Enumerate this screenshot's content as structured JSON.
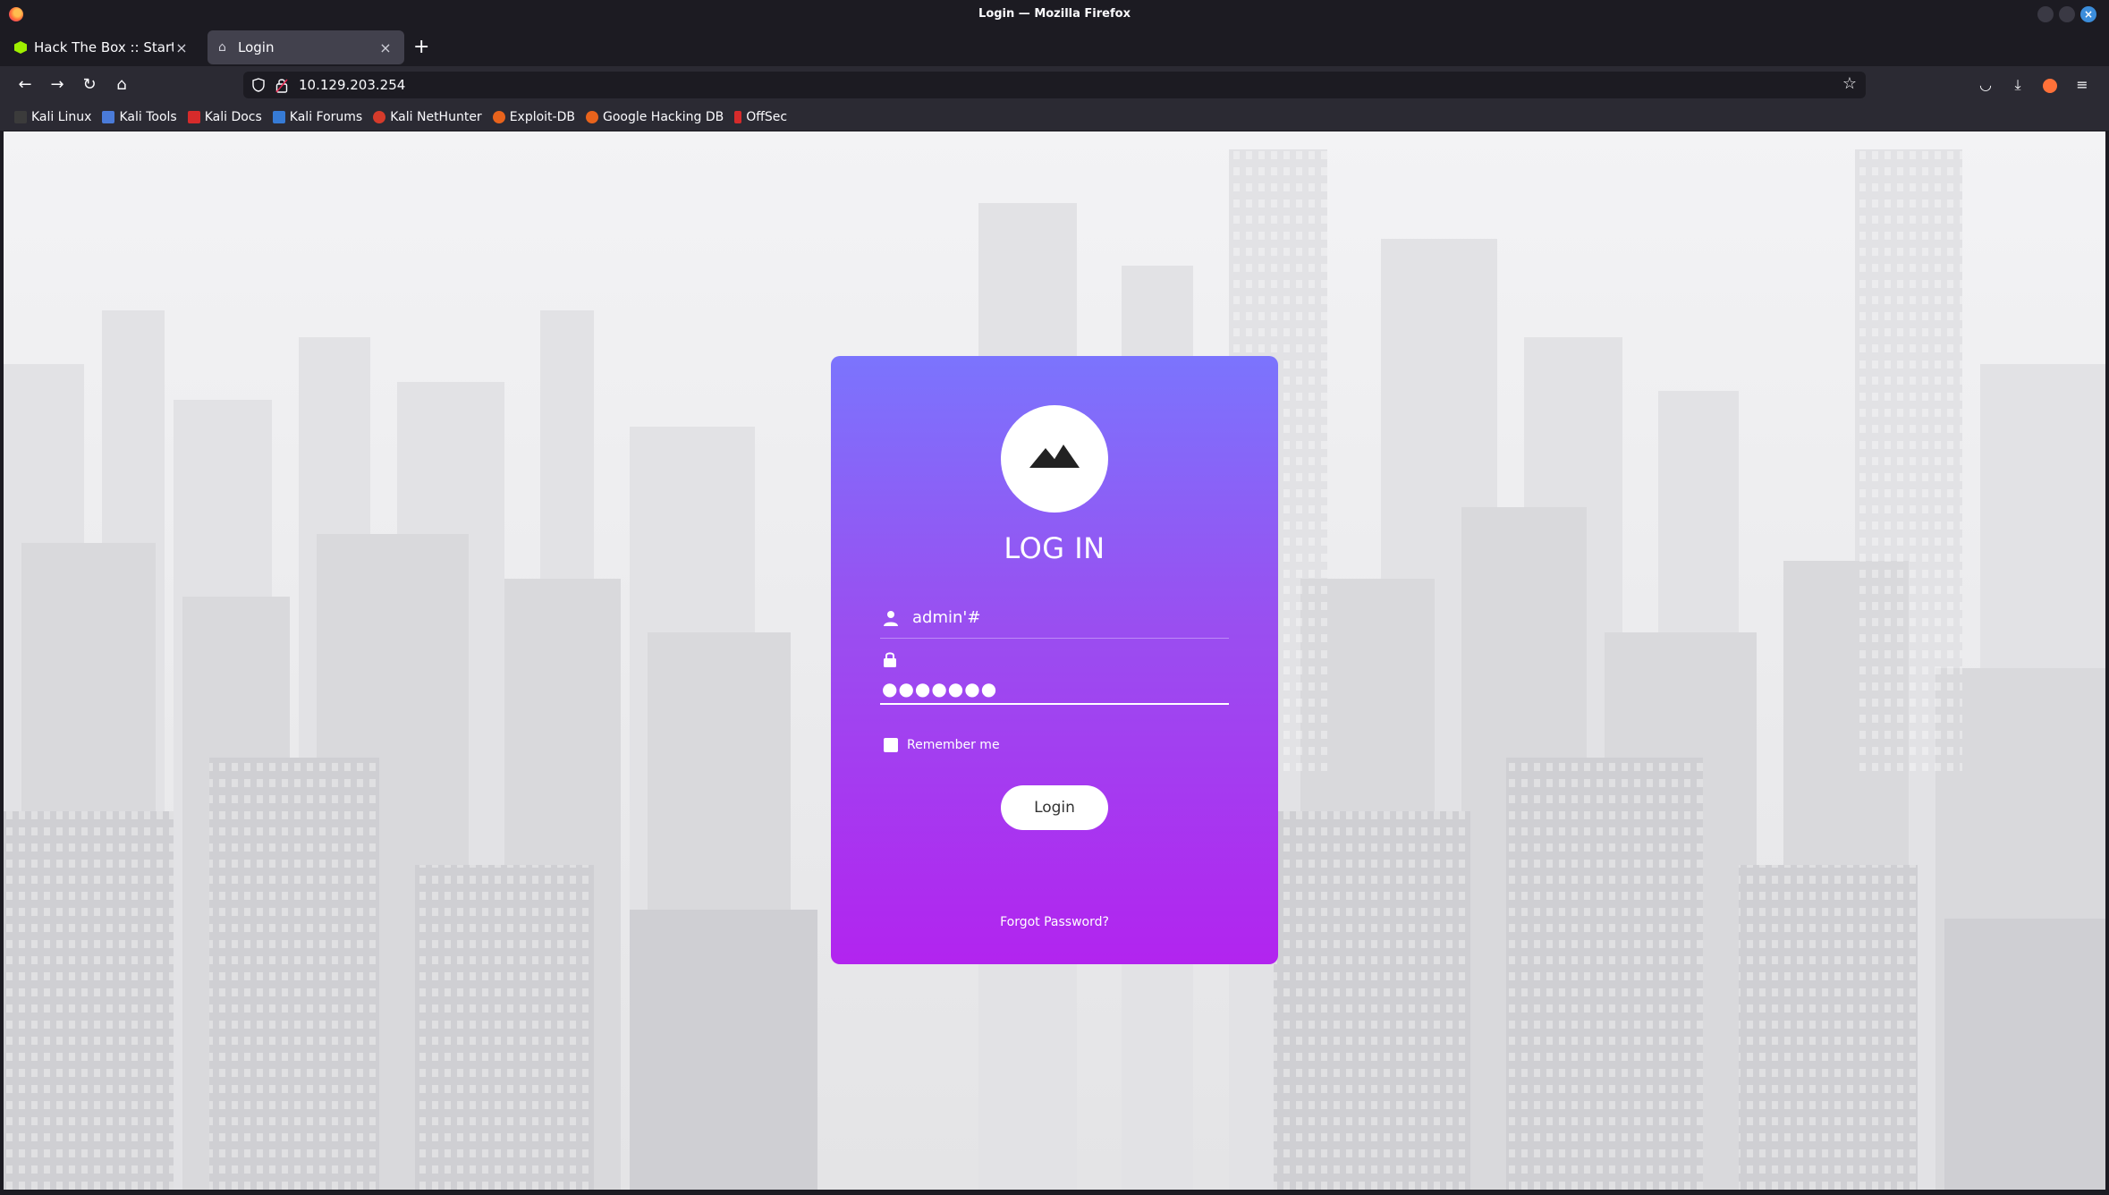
{
  "window": {
    "title": "Login — Mozilla Firefox"
  },
  "tabs": [
    {
      "label": "Hack The Box :: Starting Point",
      "icon": "hackthebox-icon",
      "active": false
    },
    {
      "label": "Login",
      "icon": "home-icon",
      "active": true
    }
  ],
  "urlbar": {
    "url": "10.129.203.254"
  },
  "bookmarks": [
    {
      "label": "Kali Linux",
      "icon": "kali-linux-icon",
      "color": "#3b3b3b"
    },
    {
      "label": "Kali Tools",
      "icon": "kali-tools-icon",
      "color": "#4a7bd9"
    },
    {
      "label": "Kali Docs",
      "icon": "kali-docs-icon",
      "color": "#d62b2b"
    },
    {
      "label": "Kali Forums",
      "icon": "kali-forums-icon",
      "color": "#367bd6"
    },
    {
      "label": "Kali NetHunter",
      "icon": "kali-nethunter-icon",
      "color": "#d63b2b"
    },
    {
      "label": "Exploit-DB",
      "icon": "exploit-db-icon",
      "color": "#e8631c"
    },
    {
      "label": "Google Hacking DB",
      "icon": "google-hacking-db-icon",
      "color": "#e8631c"
    },
    {
      "label": "OffSec",
      "icon": "offsec-icon",
      "color": "#d62b2b"
    }
  ],
  "login": {
    "title": "LOG IN",
    "username_value": "admin'#",
    "password_masked": "●●●●●●●",
    "remember_label": "Remember me",
    "remember_checked": false,
    "submit_label": "Login",
    "forgot_label": "Forgot Password?",
    "gradient_top": "#7b74fd",
    "gradient_bottom": "#b224ef"
  }
}
